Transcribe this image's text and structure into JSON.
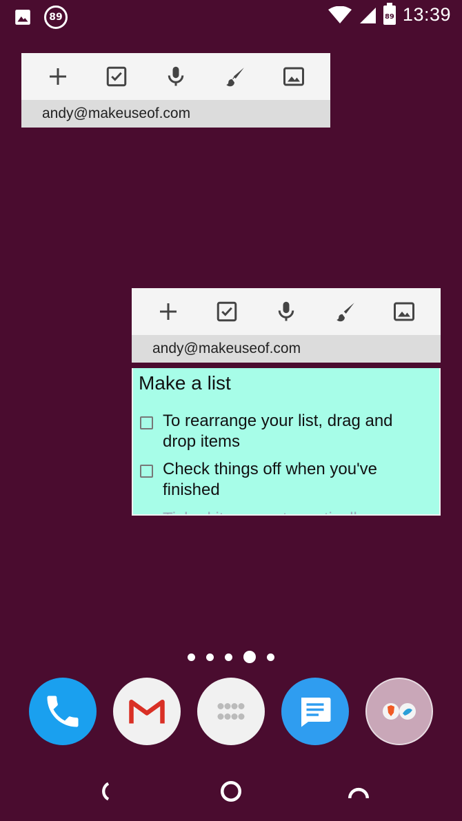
{
  "status_bar": {
    "notification_badge": "89",
    "battery_level": "89",
    "time": "13:39"
  },
  "widgets": [
    {
      "account": "andy@makeuseof.com",
      "tools": [
        "new-note-icon",
        "checklist-icon",
        "microphone-icon",
        "brush-icon",
        "image-icon"
      ]
    },
    {
      "account": "andy@makeuseof.com",
      "tools": [
        "new-note-icon",
        "checklist-icon",
        "microphone-icon",
        "brush-icon",
        "image-icon"
      ]
    }
  ],
  "note": {
    "title": "Make a list",
    "items": [
      "To rearrange your list, drag and drop items",
      "Check things off when you've finished",
      "Ticked items go to vertically"
    ],
    "background": "#a7fde8"
  },
  "home": {
    "page_count": 5,
    "active_page": 4
  },
  "dock": {
    "apps": [
      "phone",
      "gmail",
      "app-drawer",
      "messages",
      "folder"
    ]
  },
  "colors": {
    "wallpaper": "#4a0c2f",
    "phone": "#1aa0ef",
    "messages": "#2f9df0",
    "gmail_red": "#d93025"
  }
}
